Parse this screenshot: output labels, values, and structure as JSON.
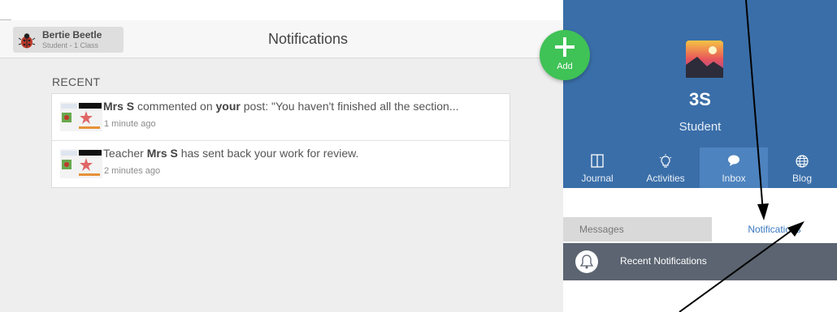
{
  "user": {
    "name": "Bertie Beetle",
    "role": "Student - 1 Class"
  },
  "header": {
    "title": "Notifications"
  },
  "recent_label": "RECENT",
  "notifications": [
    {
      "actor": "Mrs S",
      "verb": " commented on ",
      "target": "your",
      "rest": " post: \"You haven't finished all the section...",
      "time": "1 minute ago"
    },
    {
      "lead": "Teacher ",
      "actor": "Mrs S",
      "rest": " has sent back your work for review.",
      "time": "2 minutes ago"
    }
  ],
  "add_button": {
    "label": "Add"
  },
  "profile": {
    "class_name": "3S",
    "role": "Student"
  },
  "nav": [
    {
      "label": "Journal",
      "icon": "book-icon"
    },
    {
      "label": "Activities",
      "icon": "lightbulb-icon"
    },
    {
      "label": "Inbox",
      "icon": "chat-bubble-icon",
      "active": true
    },
    {
      "label": "Blog",
      "icon": "globe-icon"
    }
  ],
  "subtabs": {
    "messages": "Messages",
    "notifications": "Notifications",
    "active": "notifications"
  },
  "recent_notifications_label": "Recent Notifications",
  "colors": {
    "profile_blue": "#3a6ea8",
    "add_green": "#3fc256",
    "notif_bar": "#5b6470",
    "link_blue": "#3a78c0"
  }
}
